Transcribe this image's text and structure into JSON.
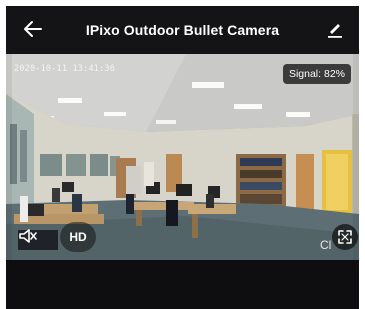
{
  "header": {
    "title": "IPixo Outdoor Bullet Camera",
    "back_icon": "arrow-left-icon",
    "edit_icon": "pencil-icon"
  },
  "video": {
    "timestamp": "2020-10-11 13:41:36",
    "signal": "Signal: 82%",
    "quality_label": "HD",
    "partial_label": "Cl",
    "mute_icon": "speaker-muted-icon",
    "fullscreen_icon": "fullscreen-icon"
  },
  "colors": {
    "topbar": "#141416",
    "bottom_bar": "#0e0e10",
    "carpet": "#5d6e74",
    "wall": "#d9d6cb"
  }
}
